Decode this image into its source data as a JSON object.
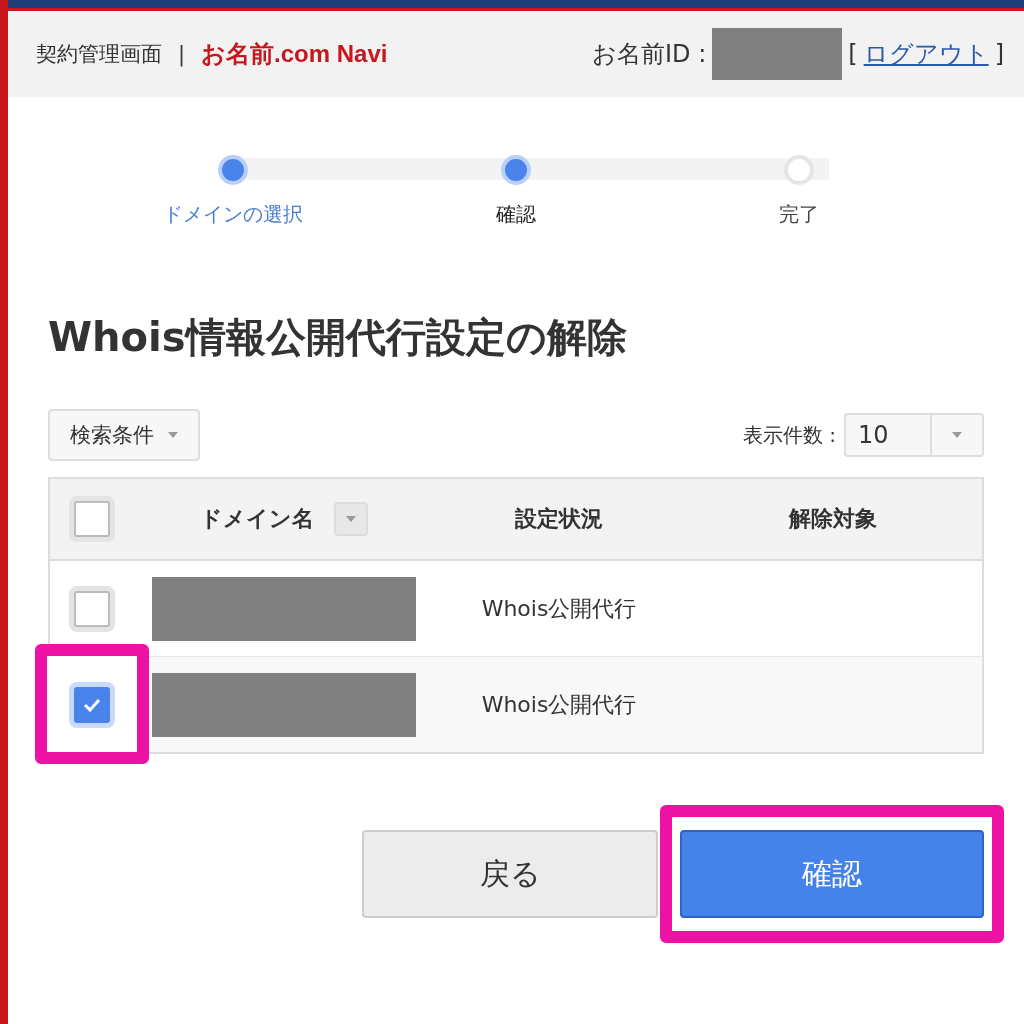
{
  "header": {
    "section": "契約管理画面",
    "separator": "|",
    "brand": "お名前.com Navi",
    "id_label": "お名前ID :",
    "id_hidden": true,
    "bracket_open": "[",
    "logout": "ログアウト",
    "bracket_close": "]"
  },
  "steps": [
    {
      "label": "ドメインの選択",
      "done": true,
      "selected": false
    },
    {
      "label": "確認",
      "done": true,
      "selected": true
    },
    {
      "label": "完了",
      "done": false,
      "selected": false
    }
  ],
  "title": "Whois情報公開代行設定の解除",
  "filter_button": "検索条件",
  "page_size": {
    "label": "表示件数 :",
    "value": "10"
  },
  "table": {
    "select_all_checked": false,
    "columns": [
      "ドメイン名",
      "設定状況",
      "解除対象"
    ],
    "rows": [
      {
        "checked": false,
        "highlighted": false,
        "domain_hidden": true,
        "status": "Whois公開代行"
      },
      {
        "checked": true,
        "highlighted": true,
        "domain_hidden": true,
        "status": "Whois公開代行"
      }
    ]
  },
  "buttons": [
    {
      "label": "戻る",
      "kind": "secondary",
      "highlighted": false
    },
    {
      "label": "確認",
      "kind": "primary",
      "highlighted": true
    }
  ]
}
